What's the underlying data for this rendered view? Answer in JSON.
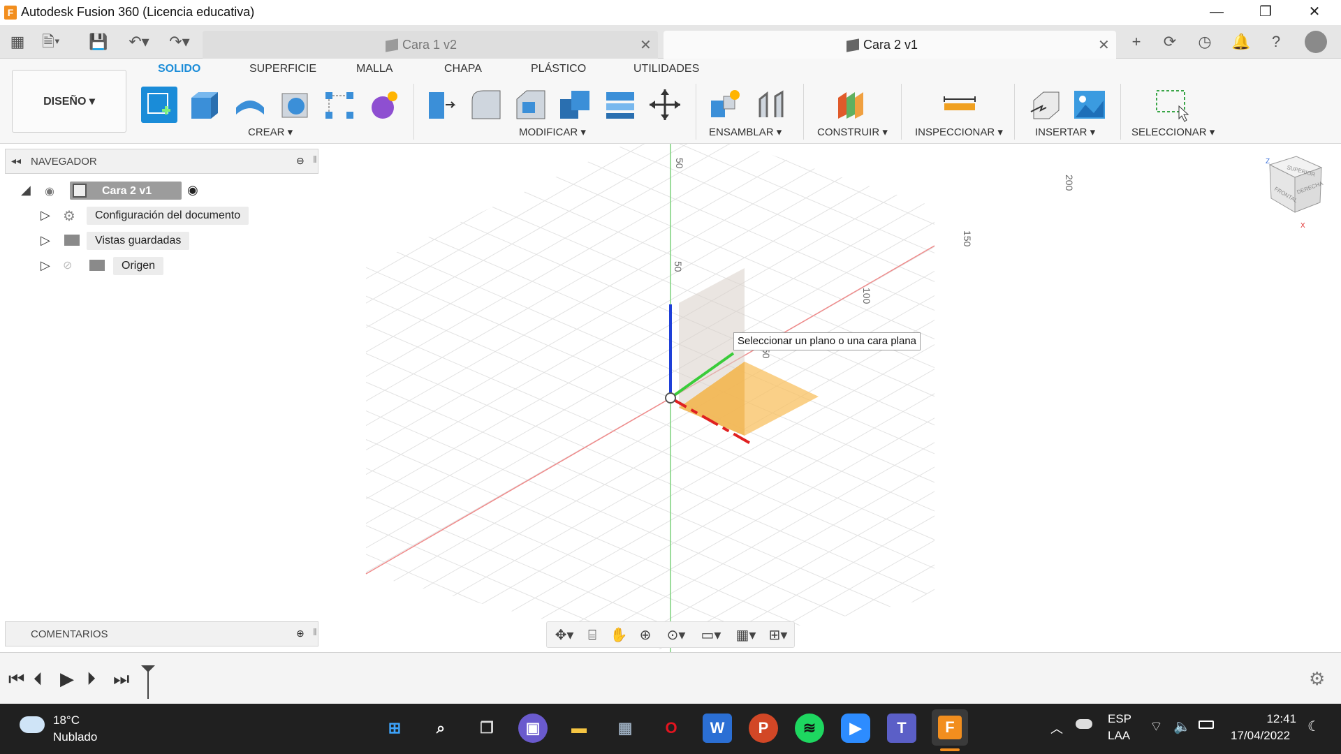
{
  "window": {
    "title": "Autodesk Fusion 360 (Licencia educativa)",
    "logo": "F"
  },
  "tabs": [
    {
      "label": "Cara 1 v2",
      "active": false
    },
    {
      "label": "Cara 2 v1",
      "active": true
    }
  ],
  "ribbon": {
    "workspace": "DISEÑO",
    "tabs": [
      "SOLIDO",
      "SUPERFICIE",
      "MALLA",
      "CHAPA",
      "PLÁSTICO",
      "UTILIDADES"
    ],
    "groups": [
      "CREAR",
      "MODIFICAR",
      "ENSAMBLAR",
      "CONSTRUIR",
      "INSPECCIONAR",
      "INSERTAR",
      "SELECCIONAR"
    ]
  },
  "navigator": {
    "title": "NAVEGADOR",
    "root": "Cara 2 v1",
    "items": [
      "Configuración del documento",
      "Vistas guardadas",
      "Origen"
    ]
  },
  "comments": {
    "title": "COMENTARIOS"
  },
  "viewport": {
    "tooltip": "Seleccionar un plano o una cara plana",
    "rulers": [
      "50",
      "50",
      "100",
      "150",
      "200",
      "50"
    ],
    "viewcube": [
      "FRONTAL",
      "DERECHA",
      "SUPERIOR"
    ]
  },
  "taskbar": {
    "weather_temp": "18°C",
    "weather_desc": "Nublado",
    "lang": "ESP",
    "lang2": "LAA",
    "time": "12:41",
    "date": "17/04/2022"
  },
  "colors": {
    "accent": "#1a8cd8",
    "orange": "#f7a830",
    "taskbar": "#202020"
  }
}
